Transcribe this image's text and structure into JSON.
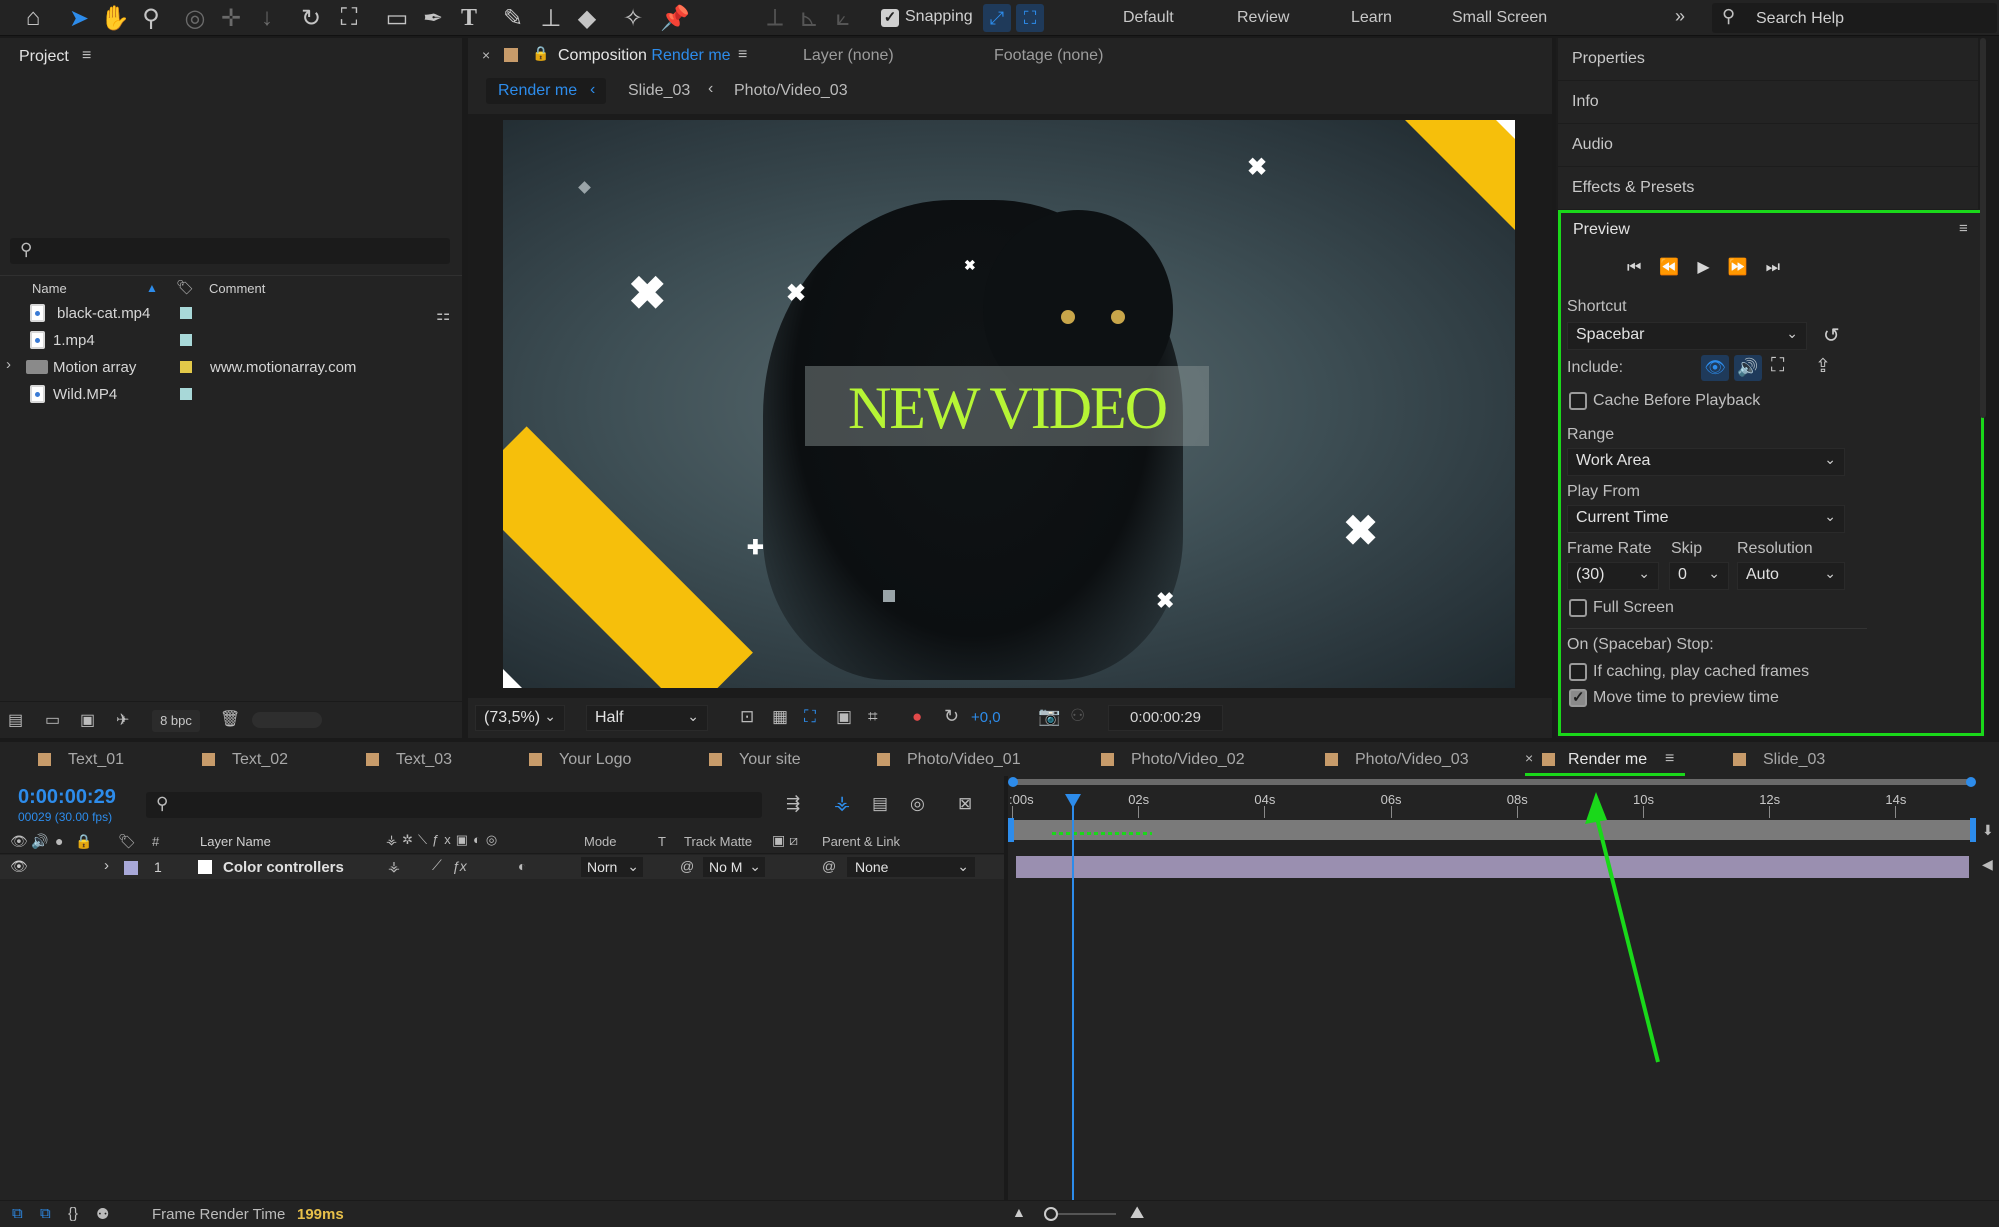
{
  "toolbar": {
    "snapping_label": "Snapping",
    "workspaces": [
      "Default",
      "Review",
      "Learn",
      "Small Screen"
    ],
    "search_placeholder": "Search Help"
  },
  "project": {
    "title": "Project",
    "col_name": "Name",
    "col_comment": "Comment",
    "files": [
      {
        "name": "black-cat.mp4",
        "comment": "",
        "type": "file",
        "color": "#a8d8d8"
      },
      {
        "name": "1.mp4",
        "comment": "",
        "type": "file",
        "color": "#a8d8d8"
      },
      {
        "name": "Motion array",
        "comment": "www.motionarray.com",
        "type": "folder",
        "color": "#e3c949"
      },
      {
        "name": "Wild.MP4",
        "comment": "",
        "type": "file",
        "color": "#a8d8d8"
      }
    ],
    "bpc": "8 bpc"
  },
  "viewer": {
    "comp_prefix": "Composition",
    "comp_name": "Render me",
    "layer_tab": "Layer (none)",
    "footage_tab": "Footage (none)",
    "breadcrumbs": [
      "Render me",
      "Slide_03",
      "Photo/Video_03"
    ],
    "headline": "NEW VIDEO",
    "zoom": "(73,5%)",
    "resolution": "Half",
    "exposure": "+0,0",
    "timecode": "0:00:00:29"
  },
  "right_panel": {
    "sections": [
      "Properties",
      "Info",
      "Audio",
      "Effects & Presets"
    ],
    "preview": {
      "title": "Preview",
      "shortcut_label": "Shortcut",
      "shortcut_value": "Spacebar",
      "include_label": "Include:",
      "cache_label": "Cache Before Playback",
      "range_label": "Range",
      "range_value": "Work Area",
      "play_from_label": "Play From",
      "play_from_value": "Current Time",
      "frame_rate_label": "Frame Rate",
      "frame_rate_value": "(30)",
      "skip_label": "Skip",
      "skip_value": "0",
      "resolution_label": "Resolution",
      "resolution_value": "Auto",
      "full_screen_label": "Full Screen",
      "stop_label": "On (Spacebar) Stop:",
      "caching_label": "If caching, play cached frames",
      "move_time_label": "Move time to preview time"
    }
  },
  "timeline": {
    "tabs": [
      {
        "label": "Text_01",
        "active": false
      },
      {
        "label": "Text_02",
        "active": false
      },
      {
        "label": "Text_03",
        "active": false
      },
      {
        "label": "Your Logo",
        "active": false
      },
      {
        "label": "Your site",
        "active": false
      },
      {
        "label": "Photo/Video_01",
        "active": false
      },
      {
        "label": "Photo/Video_02",
        "active": false
      },
      {
        "label": "Photo/Video_03",
        "active": false
      },
      {
        "label": "Render me",
        "active": true
      },
      {
        "label": "Slide_03",
        "active": false
      }
    ],
    "current_time": "0:00:00:29",
    "frame_info": "00029 (30.00 fps)",
    "columns": {
      "num": "#",
      "layer_name": "Layer Name",
      "mode": "Mode",
      "t": "T",
      "track_matte": "Track Matte",
      "parent": "Parent & Link"
    },
    "layer": {
      "index": "1",
      "name": "Color controllers",
      "mode": "Norn",
      "matte": "No M",
      "parent": "None"
    },
    "ruler_ticks": [
      ":00s",
      "02s",
      "04s",
      "06s",
      "08s",
      "10s",
      "12s",
      "14s"
    ],
    "ruler_max_seconds": 15,
    "playhead_seconds": 0.97
  },
  "status": {
    "render_label": "Frame Render Time",
    "render_value": "199ms"
  },
  "colors": {
    "highlight_green": "#1ad81a",
    "accent_blue": "#2d8ceb",
    "timecode_blue": "#2d8ceb",
    "headline_green": "#b6f535",
    "yellow": "#f6bf0b",
    "layer_bar": "#9a8fb0"
  }
}
